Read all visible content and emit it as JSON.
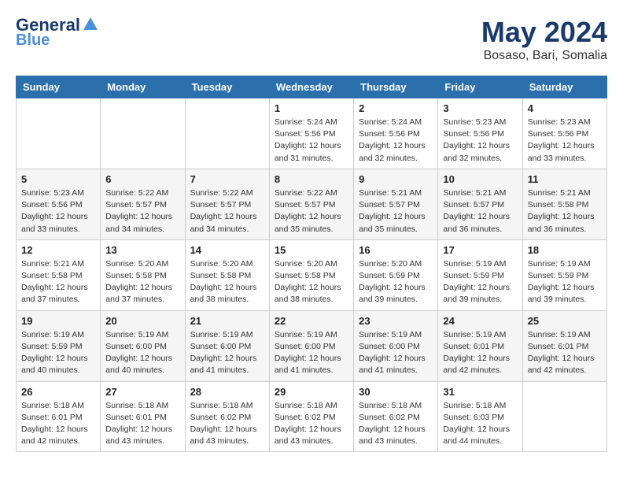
{
  "header": {
    "logo_line1": "General",
    "logo_line2": "Blue",
    "month_title": "May 2024",
    "location": "Bosaso, Bari, Somalia"
  },
  "days_of_week": [
    "Sunday",
    "Monday",
    "Tuesday",
    "Wednesday",
    "Thursday",
    "Friday",
    "Saturday"
  ],
  "weeks": [
    [
      {
        "day": "",
        "info": ""
      },
      {
        "day": "",
        "info": ""
      },
      {
        "day": "",
        "info": ""
      },
      {
        "day": "1",
        "info": "Sunrise: 5:24 AM\nSunset: 5:56 PM\nDaylight: 12 hours\nand 31 minutes."
      },
      {
        "day": "2",
        "info": "Sunrise: 5:24 AM\nSunset: 5:56 PM\nDaylight: 12 hours\nand 32 minutes."
      },
      {
        "day": "3",
        "info": "Sunrise: 5:23 AM\nSunset: 5:56 PM\nDaylight: 12 hours\nand 32 minutes."
      },
      {
        "day": "4",
        "info": "Sunrise: 5:23 AM\nSunset: 5:56 PM\nDaylight: 12 hours\nand 33 minutes."
      }
    ],
    [
      {
        "day": "5",
        "info": "Sunrise: 5:23 AM\nSunset: 5:56 PM\nDaylight: 12 hours\nand 33 minutes."
      },
      {
        "day": "6",
        "info": "Sunrise: 5:22 AM\nSunset: 5:57 PM\nDaylight: 12 hours\nand 34 minutes."
      },
      {
        "day": "7",
        "info": "Sunrise: 5:22 AM\nSunset: 5:57 PM\nDaylight: 12 hours\nand 34 minutes."
      },
      {
        "day": "8",
        "info": "Sunrise: 5:22 AM\nSunset: 5:57 PM\nDaylight: 12 hours\nand 35 minutes."
      },
      {
        "day": "9",
        "info": "Sunrise: 5:21 AM\nSunset: 5:57 PM\nDaylight: 12 hours\nand 35 minutes."
      },
      {
        "day": "10",
        "info": "Sunrise: 5:21 AM\nSunset: 5:57 PM\nDaylight: 12 hours\nand 36 minutes."
      },
      {
        "day": "11",
        "info": "Sunrise: 5:21 AM\nSunset: 5:58 PM\nDaylight: 12 hours\nand 36 minutes."
      }
    ],
    [
      {
        "day": "12",
        "info": "Sunrise: 5:21 AM\nSunset: 5:58 PM\nDaylight: 12 hours\nand 37 minutes."
      },
      {
        "day": "13",
        "info": "Sunrise: 5:20 AM\nSunset: 5:58 PM\nDaylight: 12 hours\nand 37 minutes."
      },
      {
        "day": "14",
        "info": "Sunrise: 5:20 AM\nSunset: 5:58 PM\nDaylight: 12 hours\nand 38 minutes."
      },
      {
        "day": "15",
        "info": "Sunrise: 5:20 AM\nSunset: 5:58 PM\nDaylight: 12 hours\nand 38 minutes."
      },
      {
        "day": "16",
        "info": "Sunrise: 5:20 AM\nSunset: 5:59 PM\nDaylight: 12 hours\nand 39 minutes."
      },
      {
        "day": "17",
        "info": "Sunrise: 5:19 AM\nSunset: 5:59 PM\nDaylight: 12 hours\nand 39 minutes."
      },
      {
        "day": "18",
        "info": "Sunrise: 5:19 AM\nSunset: 5:59 PM\nDaylight: 12 hours\nand 39 minutes."
      }
    ],
    [
      {
        "day": "19",
        "info": "Sunrise: 5:19 AM\nSunset: 5:59 PM\nDaylight: 12 hours\nand 40 minutes."
      },
      {
        "day": "20",
        "info": "Sunrise: 5:19 AM\nSunset: 6:00 PM\nDaylight: 12 hours\nand 40 minutes."
      },
      {
        "day": "21",
        "info": "Sunrise: 5:19 AM\nSunset: 6:00 PM\nDaylight: 12 hours\nand 41 minutes."
      },
      {
        "day": "22",
        "info": "Sunrise: 5:19 AM\nSunset: 6:00 PM\nDaylight: 12 hours\nand 41 minutes."
      },
      {
        "day": "23",
        "info": "Sunrise: 5:19 AM\nSunset: 6:00 PM\nDaylight: 12 hours\nand 41 minutes."
      },
      {
        "day": "24",
        "info": "Sunrise: 5:19 AM\nSunset: 6:01 PM\nDaylight: 12 hours\nand 42 minutes."
      },
      {
        "day": "25",
        "info": "Sunrise: 5:19 AM\nSunset: 6:01 PM\nDaylight: 12 hours\nand 42 minutes."
      }
    ],
    [
      {
        "day": "26",
        "info": "Sunrise: 5:18 AM\nSunset: 6:01 PM\nDaylight: 12 hours\nand 42 minutes."
      },
      {
        "day": "27",
        "info": "Sunrise: 5:18 AM\nSunset: 6:01 PM\nDaylight: 12 hours\nand 43 minutes."
      },
      {
        "day": "28",
        "info": "Sunrise: 5:18 AM\nSunset: 6:02 PM\nDaylight: 12 hours\nand 43 minutes."
      },
      {
        "day": "29",
        "info": "Sunrise: 5:18 AM\nSunset: 6:02 PM\nDaylight: 12 hours\nand 43 minutes."
      },
      {
        "day": "30",
        "info": "Sunrise: 5:18 AM\nSunset: 6:02 PM\nDaylight: 12 hours\nand 43 minutes."
      },
      {
        "day": "31",
        "info": "Sunrise: 5:18 AM\nSunset: 6:03 PM\nDaylight: 12 hours\nand 44 minutes."
      },
      {
        "day": "",
        "info": ""
      }
    ]
  ]
}
